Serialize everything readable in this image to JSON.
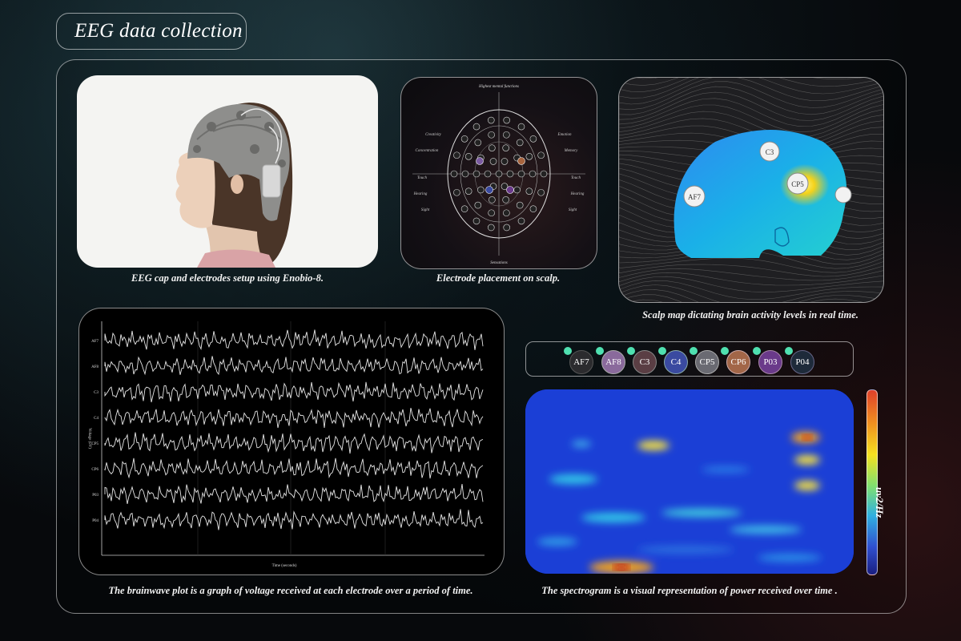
{
  "header": {
    "title": "EEG data collection"
  },
  "captions": {
    "cap_photo": "EEG cap and electrodes setup using Enobio-8.",
    "electrode_map": "Electrode placement on scalp.",
    "scalp_map": "Scalp map dictating brain activity levels in real time.",
    "brainwave": "The brainwave plot is a graph of voltage received at each electrode over a period of time.",
    "spectrogram": "The spectrogram is a visual representation of power received over time ."
  },
  "electrode_map": {
    "top_label": "Highest mental functions",
    "bottom_label": "Sensations",
    "left_labels": [
      "Creativity",
      "Concentration",
      "Touch",
      "Hearing",
      "Sight"
    ],
    "right_labels": [
      "Emotion",
      "Memory",
      "Touch",
      "Hearing",
      "Sight"
    ]
  },
  "scalp_map": {
    "markers": [
      "AF7",
      "C3",
      "CP5"
    ]
  },
  "brainwave": {
    "channels": [
      "AF7",
      "AF8",
      "C3",
      "C4",
      "CP5",
      "CP6",
      "P03",
      "P04"
    ],
    "x_label": "Time (seconds)",
    "y_label": "Voltage (uV)"
  },
  "electrodes": {
    "chips": [
      {
        "label": "AF7",
        "color": "#2b2b2e"
      },
      {
        "label": "AF8",
        "color": "#8a6a9c"
      },
      {
        "label": "C3",
        "color": "#5a3e44"
      },
      {
        "label": "C4",
        "color": "#3a4aa0"
      },
      {
        "label": "CP5",
        "color": "#6a6a72"
      },
      {
        "label": "CP6",
        "color": "#a26648"
      },
      {
        "label": "P03",
        "color": "#6a3a8a"
      },
      {
        "label": "P04",
        "color": "#1e2a3a"
      }
    ]
  },
  "spectrogram": {
    "colorbar_label": "uv2/Hz"
  }
}
